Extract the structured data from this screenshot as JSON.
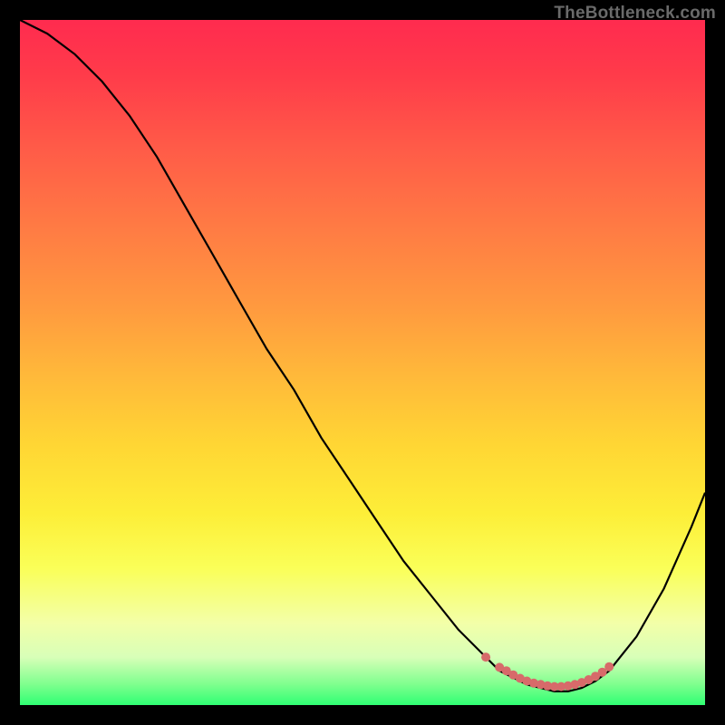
{
  "watermark": "TheBottleneck.com",
  "chart_data": {
    "type": "line",
    "title": "",
    "xlabel": "",
    "ylabel": "",
    "xlim": [
      0,
      100
    ],
    "ylim": [
      0,
      100
    ],
    "grid": false,
    "series": [
      {
        "name": "curve",
        "x": [
          0,
          4,
          8,
          12,
          16,
          20,
          24,
          28,
          32,
          36,
          40,
          44,
          48,
          52,
          56,
          60,
          64,
          68,
          70,
          72,
          74,
          76,
          78,
          80,
          82,
          84,
          86,
          90,
          94,
          98,
          100
        ],
        "y": [
          100,
          98,
          95,
          91,
          86,
          80,
          73,
          66,
          59,
          52,
          46,
          39,
          33,
          27,
          21,
          16,
          11,
          7,
          5,
          4,
          3,
          2.5,
          2,
          2,
          2.5,
          3.5,
          5,
          10,
          17,
          26,
          31
        ]
      },
      {
        "name": "dots",
        "x": [
          68,
          70,
          71,
          72,
          73,
          74,
          75,
          76,
          77,
          78,
          79,
          80,
          81,
          82,
          83,
          84,
          85,
          86
        ],
        "y": [
          7,
          5.5,
          5,
          4.4,
          3.9,
          3.5,
          3.2,
          3,
          2.8,
          2.7,
          2.7,
          2.8,
          3,
          3.3,
          3.7,
          4.2,
          4.8,
          5.6
        ]
      }
    ],
    "colors": {
      "curve": "#000000",
      "dots": "#d76a6a"
    }
  }
}
